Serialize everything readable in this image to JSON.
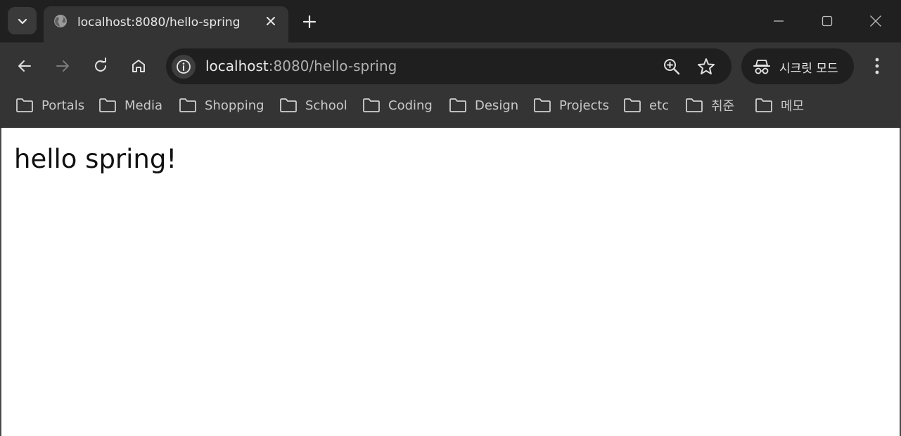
{
  "tab": {
    "title": "localhost:8080/hello-spring"
  },
  "omnibox": {
    "host": "localhost",
    "rest": ":8080/hello-spring"
  },
  "incognito": {
    "label": "시크릿 모드"
  },
  "bookmarks": [
    "Portals",
    "Media",
    "Shopping",
    "School",
    "Coding",
    "Design",
    "Projects",
    "etc",
    "취준",
    "메모"
  ],
  "page": {
    "heading": "hello spring!"
  },
  "colors": {
    "frame": "#202020",
    "toolbar": "#343434",
    "omnibox": "#1f1f1f",
    "content": "#ffffff"
  }
}
